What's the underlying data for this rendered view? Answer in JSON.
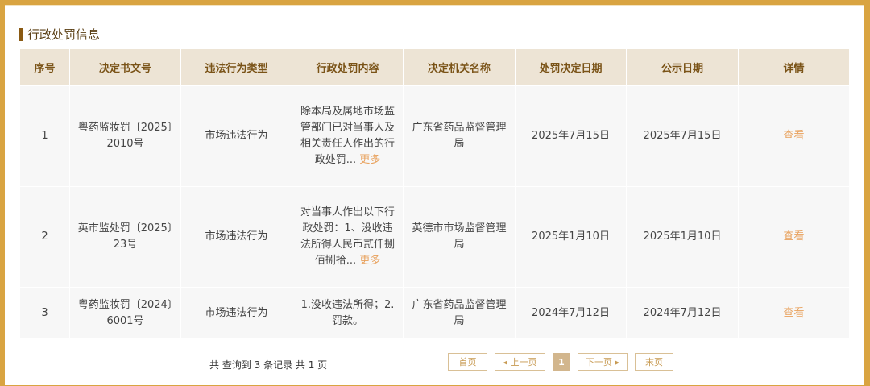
{
  "section": {
    "title": "行政处罚信息"
  },
  "table": {
    "headers": [
      "序号",
      "决定书文号",
      "违法行为类型",
      "行政处罚内容",
      "决定机关名称",
      "处罚决定日期",
      "公示日期",
      "详情"
    ],
    "rows": [
      {
        "no": "1",
        "doc": "粤药监妆罚〔2025〕2010号",
        "type": "市场违法行为",
        "content": "除本局及属地市场监管部门已对当事人及相关责任人作出的行政处罚...",
        "more": "更多",
        "org": "广东省药品监督管理局",
        "decision_date": "2025年7月15日",
        "publish_date": "2025年7月15日",
        "detail": "查看"
      },
      {
        "no": "2",
        "doc": "英市监处罚〔2025〕23号",
        "type": "市场违法行为",
        "content": "对当事人作出以下行政处罚：1、没收违法所得人民币贰仟捌佰捌拾...",
        "more": "更多",
        "org": "英德市市场监督管理局",
        "decision_date": "2025年1月10日",
        "publish_date": "2025年1月10日",
        "detail": "查看"
      },
      {
        "no": "3",
        "doc": "粤药监妆罚〔2024〕6001号",
        "type": "市场违法行为",
        "content": "1.没收违法所得；2.罚款。",
        "org": "广东省药品监督管理局",
        "decision_date": "2024年7月12日",
        "publish_date": "2024年7月12日",
        "detail": "查看"
      }
    ]
  },
  "footer": {
    "total": "共 查询到 3 条记录 共 1 页",
    "pager": {
      "first": "首页",
      "prev": "◂ 上一页",
      "current": "1",
      "next": "下一页 ▸",
      "last": "末页"
    }
  },
  "colors": {
    "accent": "#d9a441",
    "header_bg": "#ede4d5",
    "link": "#e8a15c"
  }
}
